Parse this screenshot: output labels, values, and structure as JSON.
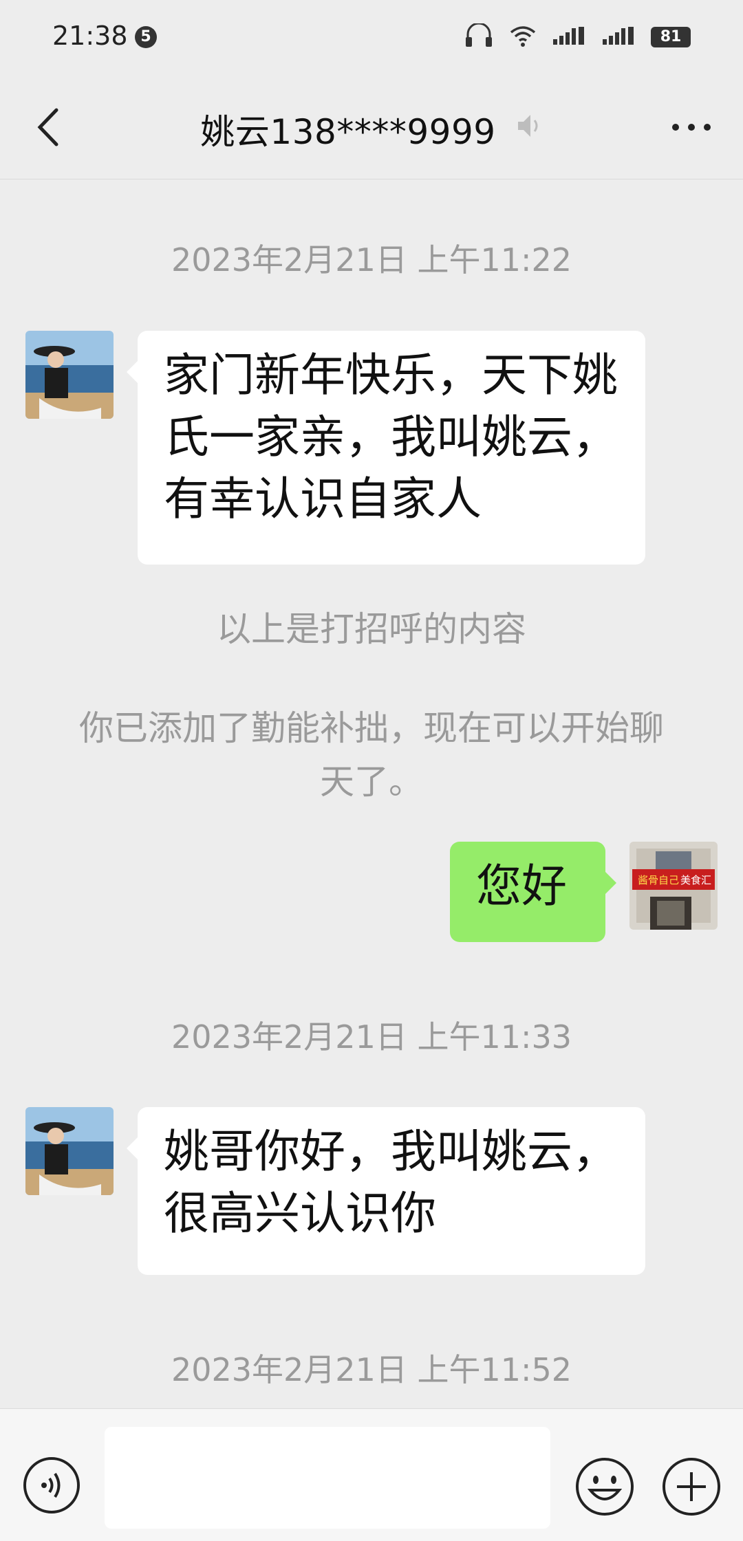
{
  "status_bar": {
    "time": "21:38",
    "notification_count": "5",
    "battery": "81"
  },
  "header": {
    "title": "姚云138****9999",
    "icons": [
      "back-icon",
      "mute-icon",
      "more-icon"
    ]
  },
  "messages": {
    "t1": "2023年2月21日 上午11:22",
    "m1": "家门新年快乐，天下姚氏一家亲，我叫姚云，有幸认识自家人",
    "sys1": "以上是打招呼的内容",
    "sys2": "你已添加了勤能补拙，现在可以开始聊天了。",
    "m2": "您好",
    "t2": "2023年2月21日 上午11:33",
    "m3": "姚哥你好，我叫姚云，很高兴认识你",
    "t3": "2023年2月21日 上午11:52",
    "shop_sign_left": "酱骨自己",
    "shop_sign_right": "美食汇"
  },
  "input_bar": {
    "value": "",
    "icons": [
      "voice-icon",
      "emoji-icon",
      "plus-icon"
    ]
  },
  "colors": {
    "background": "#ededed",
    "sent_bubble": "#95ec69",
    "received_bubble": "#ffffff"
  }
}
